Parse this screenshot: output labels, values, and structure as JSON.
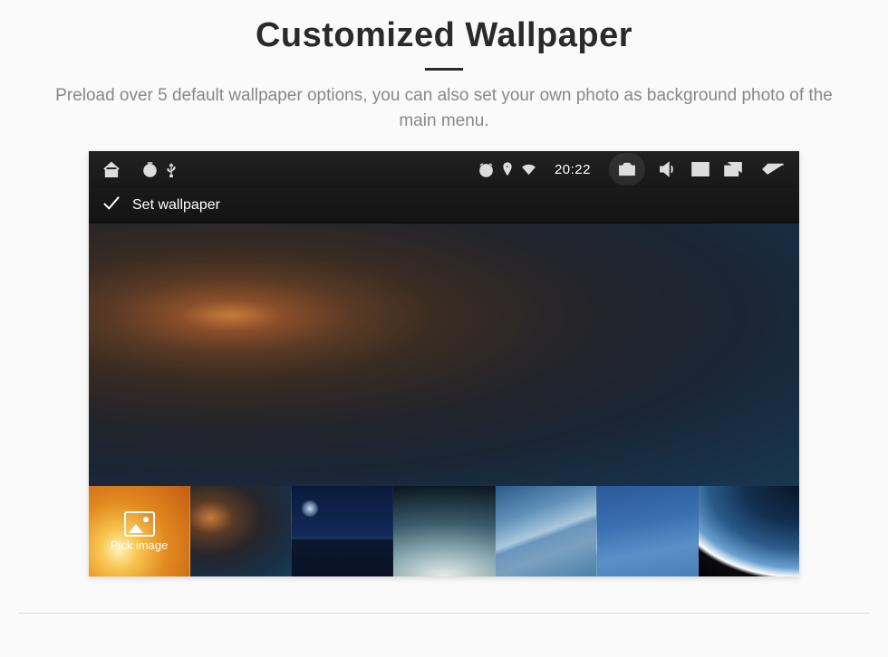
{
  "title": "Customized Wallpaper",
  "subtitle": "Preload over 5 default wallpaper options, you can also set your own photo as background photo of the main menu.",
  "statusbar": {
    "time": "20:22"
  },
  "actionbar": {
    "set_wallpaper_label": "Set wallpaper"
  },
  "thumbs": {
    "pick_image_label": "Pick image"
  }
}
